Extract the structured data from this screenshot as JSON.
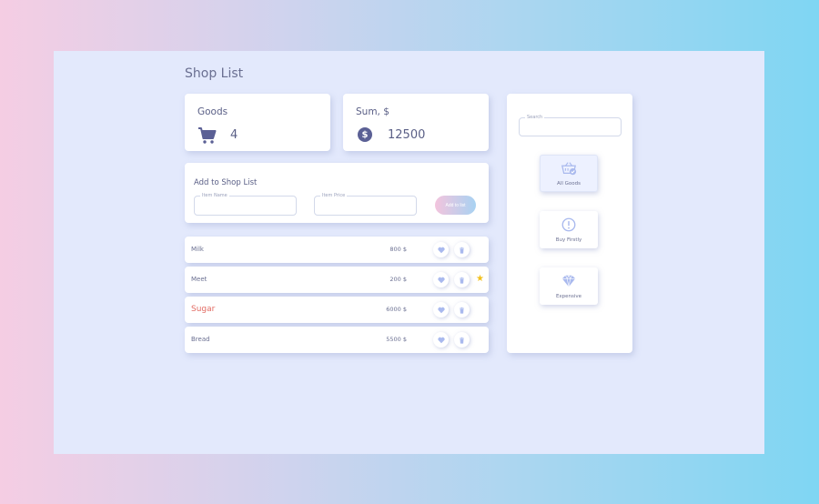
{
  "page_title": "Shop List",
  "stats": {
    "goods_label": "Goods",
    "goods_count": "4",
    "sum_label": "Sum, $",
    "sum_value": "12500"
  },
  "form": {
    "title": "Add to Shop List",
    "name_label": "Item Name",
    "price_label": "Item Price",
    "add_button": "Add to list"
  },
  "items": [
    {
      "name": "Milk",
      "price": "800 $",
      "starred": false,
      "highlight": false
    },
    {
      "name": "Meet",
      "price": "200 $",
      "starred": true,
      "highlight": false
    },
    {
      "name": "Sugar",
      "price": "6000 $",
      "starred": false,
      "highlight": true
    },
    {
      "name": "Bread",
      "price": "5500 $",
      "starred": false,
      "highlight": false
    }
  ],
  "sidebar": {
    "search_label": "Search",
    "categories": [
      {
        "label": "All Goods",
        "icon": "basket-check-icon",
        "active": true
      },
      {
        "label": "Buy Firstly",
        "icon": "exclamation-circle-icon",
        "active": false
      },
      {
        "label": "Expensive",
        "icon": "diamond-icon",
        "active": false
      }
    ]
  },
  "colors": {
    "accent": "#5b6095",
    "icon_light": "#a9b9ee",
    "star": "#f2c01d",
    "highlight_text": "#e26b63"
  }
}
